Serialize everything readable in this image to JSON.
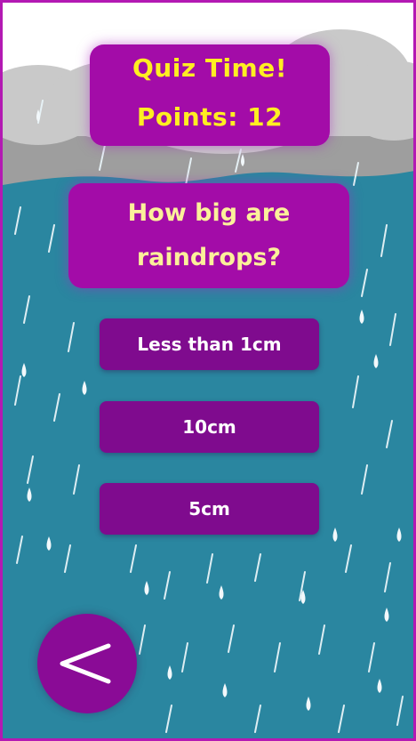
{
  "header": {
    "title": "Quiz Time!",
    "points_label": "Points: 12"
  },
  "question": {
    "text": "How big are raindrops?"
  },
  "answers": [
    {
      "label": "Less than 1cm"
    },
    {
      "label": "10cm"
    },
    {
      "label": "5cm"
    }
  ],
  "back_button": {
    "icon": "chevron-left-icon"
  },
  "colors": {
    "sea": "#2a86a0",
    "cloud": "#c9c9c9",
    "card": "#a30ca8",
    "answer": "#7f0b8e",
    "title_text": "#ffee22",
    "border": "#b319b3"
  }
}
